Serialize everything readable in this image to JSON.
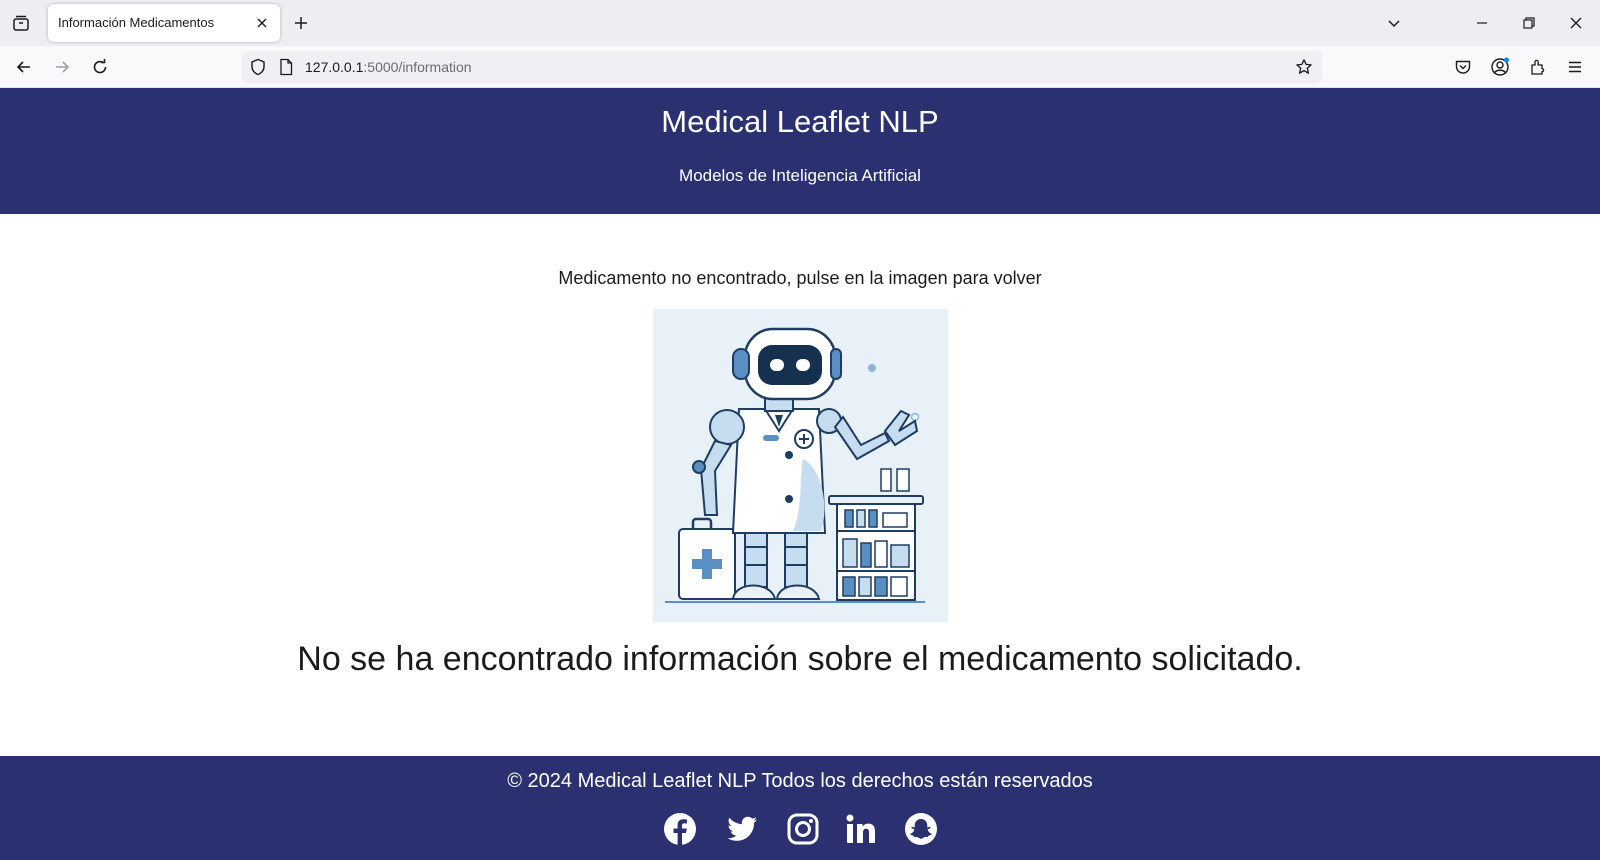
{
  "browser": {
    "tab_title": "Información Medicamentos",
    "url_host": "127.0.0.1",
    "url_rest": ":5000/information"
  },
  "header": {
    "title": "Medical Leaflet NLP",
    "subtitle": "Modelos de Inteligencia Artificial"
  },
  "main": {
    "instruction": "Medicamento no encontrado, pulse en la imagen para volver",
    "message": "No se ha encontrado información sobre el medicamento solicitado."
  },
  "footer": {
    "copyright": "© 2024 Medical Leaflet NLP Todos los derechos están reservados",
    "social": [
      "facebook-icon",
      "twitter-icon",
      "instagram-icon",
      "linkedin-icon",
      "snapchat-icon"
    ]
  },
  "colors": {
    "brand_navy": "#2b3170",
    "image_bg": "#e8f1f8",
    "robot_blue": "#5a8fc4"
  }
}
